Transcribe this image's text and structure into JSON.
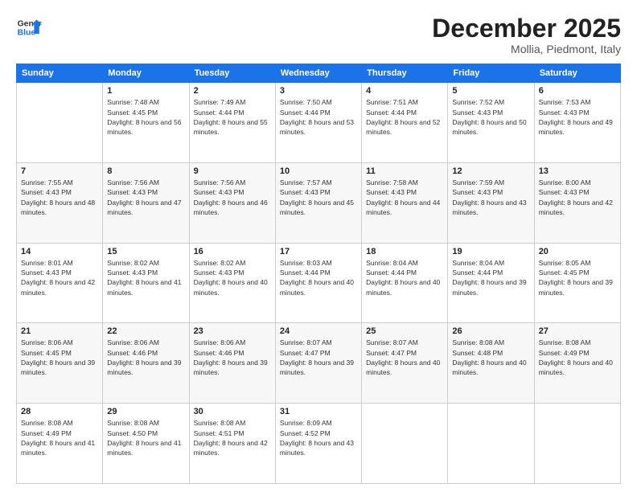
{
  "logo": {
    "line1": "General",
    "line2": "Blue"
  },
  "title": "December 2025",
  "location": "Mollia, Piedmont, Italy",
  "days_of_week": [
    "Sunday",
    "Monday",
    "Tuesday",
    "Wednesday",
    "Thursday",
    "Friday",
    "Saturday"
  ],
  "weeks": [
    [
      {
        "day": "",
        "sunrise": "",
        "sunset": "",
        "daylight": ""
      },
      {
        "day": "1",
        "sunrise": "Sunrise: 7:48 AM",
        "sunset": "Sunset: 4:45 PM",
        "daylight": "Daylight: 8 hours and 56 minutes."
      },
      {
        "day": "2",
        "sunrise": "Sunrise: 7:49 AM",
        "sunset": "Sunset: 4:44 PM",
        "daylight": "Daylight: 8 hours and 55 minutes."
      },
      {
        "day": "3",
        "sunrise": "Sunrise: 7:50 AM",
        "sunset": "Sunset: 4:44 PM",
        "daylight": "Daylight: 8 hours and 53 minutes."
      },
      {
        "day": "4",
        "sunrise": "Sunrise: 7:51 AM",
        "sunset": "Sunset: 4:44 PM",
        "daylight": "Daylight: 8 hours and 52 minutes."
      },
      {
        "day": "5",
        "sunrise": "Sunrise: 7:52 AM",
        "sunset": "Sunset: 4:43 PM",
        "daylight": "Daylight: 8 hours and 50 minutes."
      },
      {
        "day": "6",
        "sunrise": "Sunrise: 7:53 AM",
        "sunset": "Sunset: 4:43 PM",
        "daylight": "Daylight: 8 hours and 49 minutes."
      }
    ],
    [
      {
        "day": "7",
        "sunrise": "Sunrise: 7:55 AM",
        "sunset": "Sunset: 4:43 PM",
        "daylight": "Daylight: 8 hours and 48 minutes."
      },
      {
        "day": "8",
        "sunrise": "Sunrise: 7:56 AM",
        "sunset": "Sunset: 4:43 PM",
        "daylight": "Daylight: 8 hours and 47 minutes."
      },
      {
        "day": "9",
        "sunrise": "Sunrise: 7:56 AM",
        "sunset": "Sunset: 4:43 PM",
        "daylight": "Daylight: 8 hours and 46 minutes."
      },
      {
        "day": "10",
        "sunrise": "Sunrise: 7:57 AM",
        "sunset": "Sunset: 4:43 PM",
        "daylight": "Daylight: 8 hours and 45 minutes."
      },
      {
        "day": "11",
        "sunrise": "Sunrise: 7:58 AM",
        "sunset": "Sunset: 4:43 PM",
        "daylight": "Daylight: 8 hours and 44 minutes."
      },
      {
        "day": "12",
        "sunrise": "Sunrise: 7:59 AM",
        "sunset": "Sunset: 4:43 PM",
        "daylight": "Daylight: 8 hours and 43 minutes."
      },
      {
        "day": "13",
        "sunrise": "Sunrise: 8:00 AM",
        "sunset": "Sunset: 4:43 PM",
        "daylight": "Daylight: 8 hours and 42 minutes."
      }
    ],
    [
      {
        "day": "14",
        "sunrise": "Sunrise: 8:01 AM",
        "sunset": "Sunset: 4:43 PM",
        "daylight": "Daylight: 8 hours and 42 minutes."
      },
      {
        "day": "15",
        "sunrise": "Sunrise: 8:02 AM",
        "sunset": "Sunset: 4:43 PM",
        "daylight": "Daylight: 8 hours and 41 minutes."
      },
      {
        "day": "16",
        "sunrise": "Sunrise: 8:02 AM",
        "sunset": "Sunset: 4:43 PM",
        "daylight": "Daylight: 8 hours and 40 minutes."
      },
      {
        "day": "17",
        "sunrise": "Sunrise: 8:03 AM",
        "sunset": "Sunset: 4:44 PM",
        "daylight": "Daylight: 8 hours and 40 minutes."
      },
      {
        "day": "18",
        "sunrise": "Sunrise: 8:04 AM",
        "sunset": "Sunset: 4:44 PM",
        "daylight": "Daylight: 8 hours and 40 minutes."
      },
      {
        "day": "19",
        "sunrise": "Sunrise: 8:04 AM",
        "sunset": "Sunset: 4:44 PM",
        "daylight": "Daylight: 8 hours and 39 minutes."
      },
      {
        "day": "20",
        "sunrise": "Sunrise: 8:05 AM",
        "sunset": "Sunset: 4:45 PM",
        "daylight": "Daylight: 8 hours and 39 minutes."
      }
    ],
    [
      {
        "day": "21",
        "sunrise": "Sunrise: 8:06 AM",
        "sunset": "Sunset: 4:45 PM",
        "daylight": "Daylight: 8 hours and 39 minutes."
      },
      {
        "day": "22",
        "sunrise": "Sunrise: 8:06 AM",
        "sunset": "Sunset: 4:46 PM",
        "daylight": "Daylight: 8 hours and 39 minutes."
      },
      {
        "day": "23",
        "sunrise": "Sunrise: 8:06 AM",
        "sunset": "Sunset: 4:46 PM",
        "daylight": "Daylight: 8 hours and 39 minutes."
      },
      {
        "day": "24",
        "sunrise": "Sunrise: 8:07 AM",
        "sunset": "Sunset: 4:47 PM",
        "daylight": "Daylight: 8 hours and 39 minutes."
      },
      {
        "day": "25",
        "sunrise": "Sunrise: 8:07 AM",
        "sunset": "Sunset: 4:47 PM",
        "daylight": "Daylight: 8 hours and 40 minutes."
      },
      {
        "day": "26",
        "sunrise": "Sunrise: 8:08 AM",
        "sunset": "Sunset: 4:48 PM",
        "daylight": "Daylight: 8 hours and 40 minutes."
      },
      {
        "day": "27",
        "sunrise": "Sunrise: 8:08 AM",
        "sunset": "Sunset: 4:49 PM",
        "daylight": "Daylight: 8 hours and 40 minutes."
      }
    ],
    [
      {
        "day": "28",
        "sunrise": "Sunrise: 8:08 AM",
        "sunset": "Sunset: 4:49 PM",
        "daylight": "Daylight: 8 hours and 41 minutes."
      },
      {
        "day": "29",
        "sunrise": "Sunrise: 8:08 AM",
        "sunset": "Sunset: 4:50 PM",
        "daylight": "Daylight: 8 hours and 41 minutes."
      },
      {
        "day": "30",
        "sunrise": "Sunrise: 8:08 AM",
        "sunset": "Sunset: 4:51 PM",
        "daylight": "Daylight: 8 hours and 42 minutes."
      },
      {
        "day": "31",
        "sunrise": "Sunrise: 8:09 AM",
        "sunset": "Sunset: 4:52 PM",
        "daylight": "Daylight: 8 hours and 43 minutes."
      },
      {
        "day": "",
        "sunrise": "",
        "sunset": "",
        "daylight": ""
      },
      {
        "day": "",
        "sunrise": "",
        "sunset": "",
        "daylight": ""
      },
      {
        "day": "",
        "sunrise": "",
        "sunset": "",
        "daylight": ""
      }
    ]
  ]
}
